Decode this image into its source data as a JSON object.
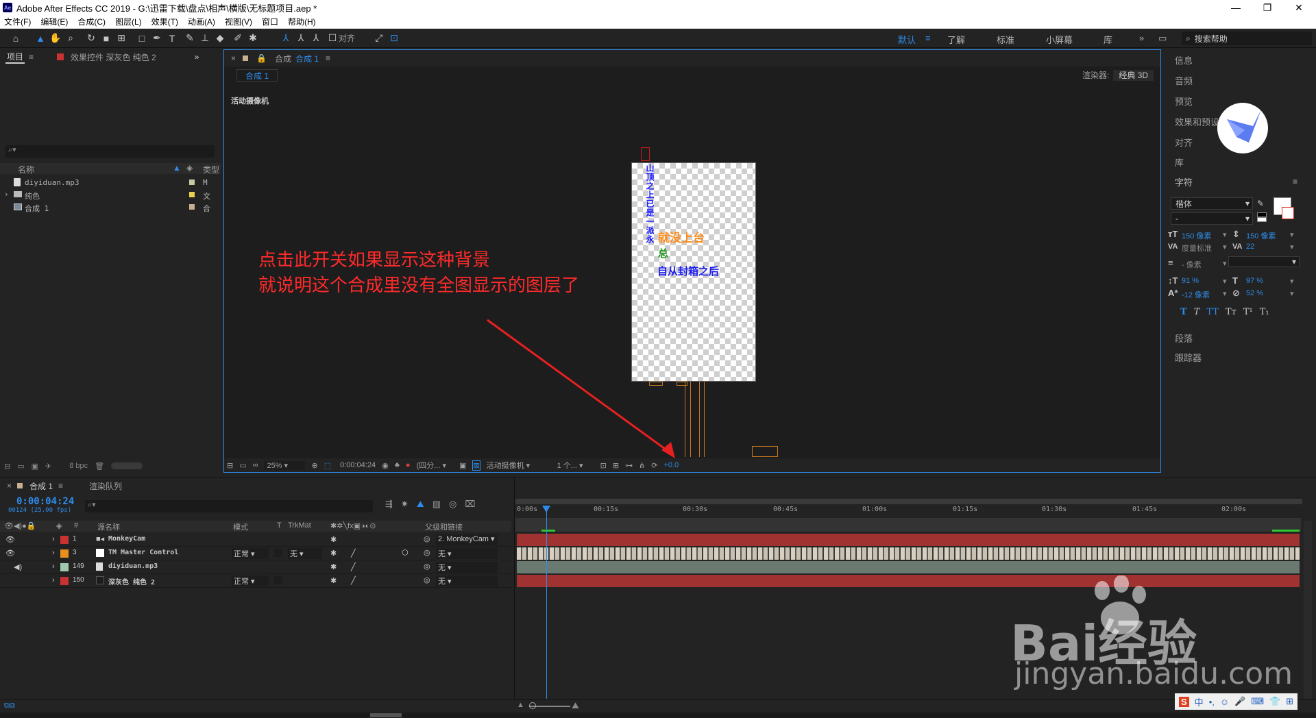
{
  "app": {
    "title": "Adobe After Effects CC 2019 - G:\\迅雷下载\\盘点\\相声\\横版\\无标题项目.aep *",
    "logo_text": "Ae"
  },
  "menu": [
    "文件(F)",
    "编辑(E)",
    "合成(C)",
    "图层(L)",
    "效果(T)",
    "动画(A)",
    "视图(V)",
    "窗口",
    "帮助(H)"
  ],
  "toolbar": {
    "snap_label": "对齐",
    "workspaces": [
      "默认",
      "了解",
      "标准",
      "小屏幕",
      "库"
    ],
    "active_workspace": "默认",
    "help_search_placeholder": "搜索帮助"
  },
  "project": {
    "tab_label": "项目",
    "effects_tab_label": "效果控件 深灰色 纯色 2",
    "search_placeholder": "",
    "col_name": "名称",
    "col_type": "类型",
    "items": [
      {
        "name": "diyiduan.mp3",
        "type": "M",
        "color": "#c8c8a0"
      },
      {
        "name": "纯色",
        "type": "文",
        "color": "#e8d050"
      },
      {
        "name": "合成 1",
        "type": "合",
        "color": "#c8b090"
      }
    ],
    "bpc": "8 bpc"
  },
  "comp": {
    "tab_prefix": "合成",
    "tab_name": "合成 1",
    "sub_tab": "合成 1",
    "renderer_label": "渲染器:",
    "renderer_value": "经典 3D",
    "active_camera": "活动摄像机",
    "canvas_texts": {
      "vertical": "山顶之上已是一派永",
      "line1": "就没上台",
      "line2": "总",
      "line3": "自从封箱之后"
    },
    "annotation_lines": [
      "点击此开关如果显示这种背景",
      "就说明这个合成里没有全图显示的图层了"
    ],
    "footer": {
      "zoom": "25%",
      "timecode": "0:00:04:24",
      "resolution": "(四分...",
      "camera": "活动摄像机",
      "views": "1 个...",
      "exposure": "+0.0"
    }
  },
  "right_panel": {
    "items": [
      "信息",
      "音频",
      "预览",
      "效果和预设",
      "对齐",
      "库",
      "字符",
      "段落",
      "跟踪器"
    ],
    "character": {
      "font_family": "楷体",
      "font_style": "-",
      "font_size": "150 像素",
      "leading": "150 像素",
      "kerning": "度量标准",
      "tracking": "22",
      "stroke": "- 像素",
      "vscale": "91 %",
      "hscale": "97 %",
      "baseline": "-12 像素",
      "tsume": "52 %",
      "styles": [
        "T",
        "T",
        "TT",
        "Tт",
        "T¹",
        "T₁"
      ]
    }
  },
  "timeline": {
    "tab_label": "合成 1",
    "render_queue_label": "渲染队列",
    "timecode": "0:00:04:24",
    "fps": "00124 (25.00 fps)",
    "columns": {
      "num": "#",
      "source": "源名称",
      "mode": "模式",
      "t": "T",
      "trkmat": "TrkMat",
      "parent": "父级和链接"
    },
    "ruler": [
      "0:00s",
      "00:15s",
      "00:30s",
      "00:45s",
      "01:00s",
      "01:15s",
      "01:30s",
      "01:45s",
      "02:00s"
    ],
    "layers": [
      {
        "num": "1",
        "name": "MonkeyCam",
        "label": "#c83232",
        "mode": "",
        "trkmat": "",
        "parent": "2. MonkeyCam"
      },
      {
        "num": "3",
        "name": "TM Master Control",
        "label": "#e8901e",
        "mode": "正常",
        "trkmat": "无",
        "parent": "无"
      },
      {
        "num": "149",
        "name": "diyiduan.mp3",
        "label": "#a0c8b0",
        "mode": "",
        "trkmat": "",
        "parent": "无"
      },
      {
        "num": "150",
        "name": "深灰色 纯色 2",
        "label": "#c83232",
        "mode": "正常",
        "trkmat": "",
        "parent": "无"
      }
    ]
  },
  "watermark": {
    "brand": "Bai经验",
    "url": "jingyan.baidu.com"
  },
  "colors": {
    "accent": "#2d8ceb",
    "annotation": "#ff2a2a",
    "layer_red": "#a03232"
  }
}
